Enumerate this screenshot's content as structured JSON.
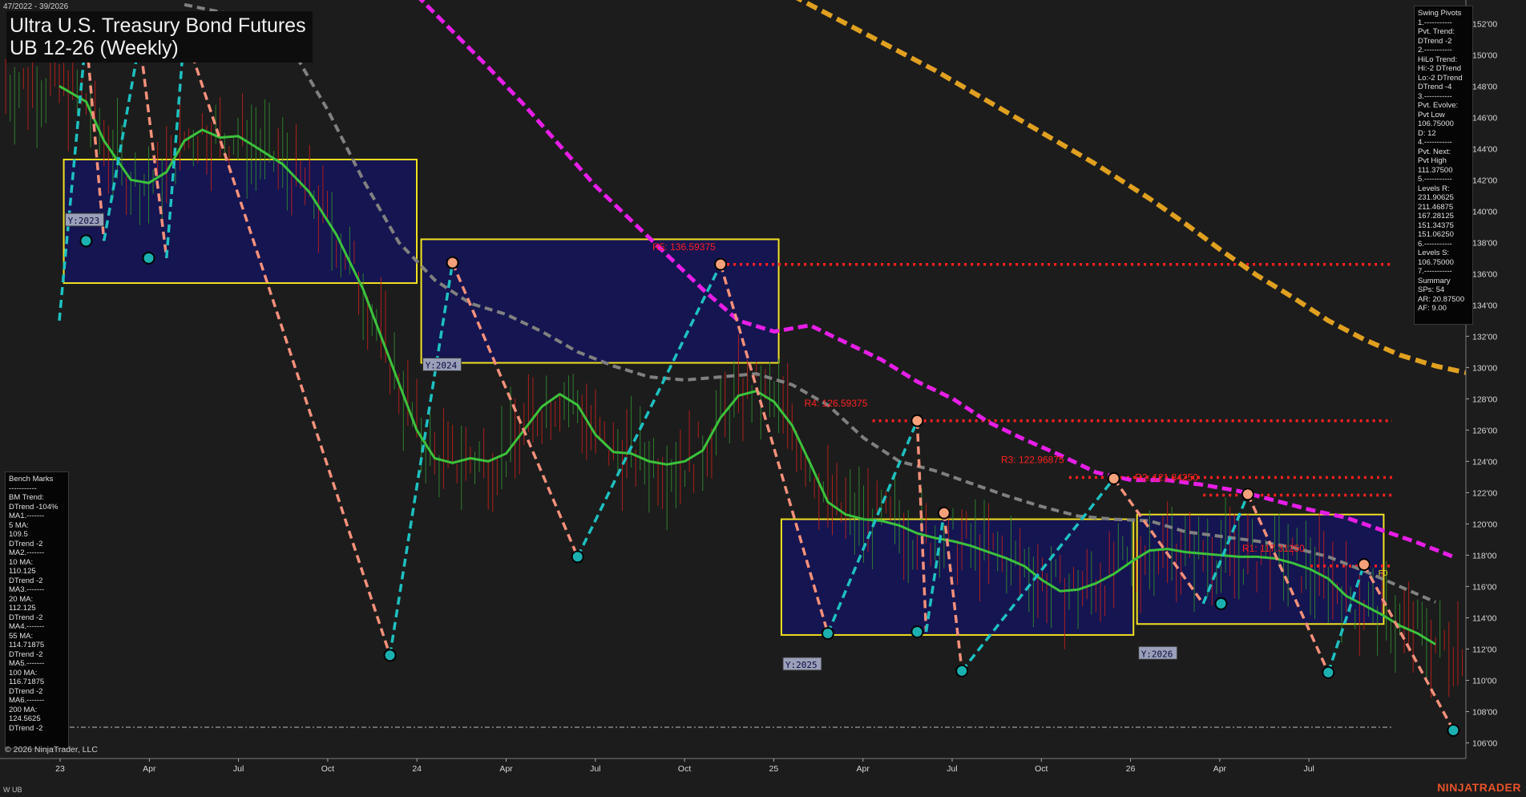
{
  "header": {
    "date_range": "47/2022 - 39/2026",
    "title_line1": "Ultra U.S. Treasury Bond Futures",
    "title_line2": "UB 12-26 (Weekly)"
  },
  "footer": {
    "copyright": "© 2026 NinjaTrader, LLC",
    "instrument": "W UB",
    "brand": "NINJATRADER"
  },
  "swing_panel": {
    "lines": [
      "Swing Pivots",
      "1.-----------",
      "Pvt. Trend:",
      "DTrend -2",
      "2.-----------",
      "HiLo Trend:",
      "Hi:-2 DTrend",
      "Lo:-2 DTrend",
      "DTrend -4",
      "3.-----------",
      "Pvt. Evolve:",
      "Pvt Low",
      "106.75000",
      "D: 12",
      "4.-----------",
      "Pvt. Next:",
      "Pvt High",
      "111.37500",
      "5.-----------",
      "Levels R:",
      "231.90625",
      "211.46875",
      "167.28125",
      "151.34375",
      "151.06250",
      "6.-----------",
      "Levels S:",
      "106.75000",
      "7.-----------",
      "Summary",
      "SPs: 54",
      "AR: 20.87500",
      "AF: 9.00"
    ]
  },
  "bench_panel": {
    "lines": [
      "Bench Marks",
      "-----------",
      "BM Trend:",
      "DTrend -104%",
      "MA1.-------",
      "5 MA:",
      "109.5",
      "DTrend -2",
      "MA2.-------",
      "10 MA:",
      "110.125",
      "DTrend -2",
      "MA3.-------",
      "20 MA:",
      "112.125",
      "DTrend -2",
      "MA4.-------",
      "55 MA:",
      "114.71875",
      "DTrend -2",
      "MA5.-------",
      "100 MA:",
      "116.71875",
      "DTrend -2",
      "MA6.-------",
      "200 MA:",
      "124.5625",
      "DTrend -2"
    ]
  },
  "colors": {
    "background": "#1c1c1c",
    "up_bar": "#2e8b2e",
    "down_bar": "#c0201a",
    "ma_fast": "#3cc23c",
    "ma_mid": "#808080",
    "ma_slow": "#e61ee6",
    "ma_longest": "#e0a020",
    "pivot_high": "#f4a07a",
    "pivot_low": "#1ab0b0",
    "swing_down": "#f4907a",
    "swing_up": "#1ec0c0",
    "resistance": "#ff2020",
    "year_box_fill": "#14145a",
    "year_box_border": "#f0e020"
  },
  "chart_data": {
    "type": "line",
    "x_axis": {
      "tick_labels": [
        "23",
        "Apr",
        "Jul",
        "Oct",
        "24",
        "Apr",
        "Jul",
        "Oct",
        "25",
        "Apr",
        "Jul",
        "Oct",
        "26",
        "Apr",
        "Jul"
      ]
    },
    "y_axis": {
      "ylim": [
        105,
        153.5
      ],
      "tick_labels": [
        "106'00",
        "108'00",
        "110'00",
        "112'00",
        "114'00",
        "116'00",
        "118'00",
        "120'00",
        "122'00",
        "124'00",
        "126'00",
        "128'00",
        "130'00",
        "132'00",
        "134'00",
        "136'00",
        "138'00",
        "140'00",
        "142'00",
        "144'00",
        "146'00",
        "148'00",
        "150'00",
        "152'00"
      ]
    },
    "year_boxes": [
      {
        "label": "Y:2023",
        "x0": 0.5,
        "x1": 40,
        "high": 143.3,
        "low": 135.4
      },
      {
        "label": "Y:2024",
        "x0": 40.5,
        "x1": 80.5,
        "high": 138.2,
        "low": 130.3
      },
      {
        "label": "Y:2025",
        "x0": 80.8,
        "x1": 120.2,
        "high": 120.3,
        "low": 112.9
      },
      {
        "label": "Y:2026",
        "x0": 120.6,
        "x1": 148.2,
        "high": 120.6,
        "low": 113.6
      }
    ],
    "resistance_levels": [
      {
        "label": "R5: 136.59375",
        "value": 136.59375,
        "x_start": 74
      },
      {
        "label": "R4: 126.59375",
        "value": 126.59375,
        "x_start": 91
      },
      {
        "label": "R3: 122.96875",
        "value": 122.96875,
        "x_start": 113
      },
      {
        "label": "R2: 121.84250",
        "value": 121.8425,
        "x_start": 128
      },
      {
        "label": "R1: 117.31250",
        "value": 117.3125,
        "x_start": 140
      }
    ],
    "f0_label": "F0",
    "support_level": 107.0,
    "pivot_lows": [
      [
        3,
        138.1
      ],
      [
        10,
        137.0
      ],
      [
        37,
        111.6
      ],
      [
        58,
        117.9
      ],
      [
        86,
        113.0
      ],
      [
        96,
        113.1
      ],
      [
        101,
        110.6
      ],
      [
        130,
        114.9
      ],
      [
        142,
        110.5
      ],
      [
        156,
        106.8
      ]
    ],
    "pivot_highs": [
      [
        3,
        151.3
      ],
      [
        10,
        150.9
      ],
      [
        44,
        136.7
      ],
      [
        74,
        136.6
      ],
      [
        96,
        126.6
      ],
      [
        99,
        120.7
      ],
      [
        118,
        122.9
      ],
      [
        133,
        121.9
      ],
      [
        146,
        117.4
      ]
    ],
    "swing_path": [
      [
        0,
        133
      ],
      [
        3,
        151.3
      ],
      [
        5,
        138.1
      ],
      [
        9,
        150.9
      ],
      [
        12,
        137.0
      ],
      [
        14,
        151.5
      ],
      [
        37,
        111.6
      ],
      [
        44,
        136.7
      ],
      [
        58,
        117.9
      ],
      [
        74,
        136.6
      ],
      [
        86,
        113.0
      ],
      [
        96,
        126.6
      ],
      [
        97,
        113.1
      ],
      [
        99,
        120.7
      ],
      [
        101,
        110.6
      ],
      [
        118,
        122.9
      ],
      [
        128,
        114.9
      ],
      [
        133,
        121.9
      ],
      [
        142,
        110.5
      ],
      [
        146,
        117.4
      ],
      [
        156,
        106.8
      ]
    ],
    "series": [
      {
        "name": "5 MA",
        "values": [
          [
            0,
            148
          ],
          [
            3,
            147
          ],
          [
            5,
            144.5
          ],
          [
            8,
            142
          ],
          [
            10,
            141.8
          ],
          [
            12,
            142.5
          ],
          [
            14,
            144.5
          ],
          [
            16,
            145.2
          ],
          [
            18,
            144.7
          ],
          [
            20,
            144.8
          ],
          [
            22,
            144.1
          ],
          [
            25,
            143
          ],
          [
            28,
            141.2
          ],
          [
            31,
            138.5
          ],
          [
            34,
            135
          ],
          [
            37,
            130.5
          ],
          [
            40,
            126
          ],
          [
            42,
            124.2
          ],
          [
            44,
            123.9
          ],
          [
            46,
            124.2
          ],
          [
            48,
            124
          ],
          [
            50,
            124.5
          ],
          [
            52,
            126
          ],
          [
            54,
            127.5
          ],
          [
            56,
            128.3
          ],
          [
            58,
            127.6
          ],
          [
            60,
            125.7
          ],
          [
            62,
            124.6
          ],
          [
            64,
            124.5
          ],
          [
            66,
            124
          ],
          [
            68,
            123.8
          ],
          [
            70,
            124
          ],
          [
            72,
            124.7
          ],
          [
            74,
            126.8
          ],
          [
            76,
            128.2
          ],
          [
            78,
            128.5
          ],
          [
            80,
            127.8
          ],
          [
            82,
            126.3
          ],
          [
            84,
            123.9
          ],
          [
            86,
            121.4
          ],
          [
            88,
            120.6
          ],
          [
            90,
            120.3
          ],
          [
            92,
            120.2
          ],
          [
            94,
            119.9
          ],
          [
            96,
            119.4
          ],
          [
            98,
            119.1
          ],
          [
            100,
            118.9
          ],
          [
            102,
            118.6
          ],
          [
            104,
            118.2
          ],
          [
            106,
            117.8
          ],
          [
            108,
            117.3
          ],
          [
            110,
            116.4
          ],
          [
            112,
            115.7
          ],
          [
            114,
            115.8
          ],
          [
            116,
            116.2
          ],
          [
            118,
            116.8
          ],
          [
            120,
            117.6
          ],
          [
            122,
            118.3
          ],
          [
            124,
            118.4
          ],
          [
            126,
            118.2
          ],
          [
            128,
            118.1
          ],
          [
            130,
            118.0
          ],
          [
            132,
            117.9
          ],
          [
            134,
            117.9
          ],
          [
            136,
            117.8
          ],
          [
            138,
            117.5
          ],
          [
            140,
            117.1
          ],
          [
            142,
            116.5
          ],
          [
            144,
            115.4
          ],
          [
            146,
            114.8
          ],
          [
            148,
            114.2
          ],
          [
            150,
            113.5
          ],
          [
            152,
            113.0
          ],
          [
            154,
            112.3
          ]
        ]
      },
      {
        "name": "20 MA",
        "values": [
          [
            14,
            153.2
          ],
          [
            20,
            152.5
          ],
          [
            26,
            150.4
          ],
          [
            30,
            146.5
          ],
          [
            34,
            142
          ],
          [
            38,
            138
          ],
          [
            42,
            135.6
          ],
          [
            46,
            134.1
          ],
          [
            50,
            133.4
          ],
          [
            54,
            132.3
          ],
          [
            58,
            131.0
          ],
          [
            62,
            130.1
          ],
          [
            66,
            129.4
          ],
          [
            70,
            129.2
          ],
          [
            74,
            129.4
          ],
          [
            78,
            129.6
          ],
          [
            82,
            128.9
          ],
          [
            86,
            127.6
          ],
          [
            90,
            125.5
          ],
          [
            94,
            124.0
          ],
          [
            98,
            123.4
          ],
          [
            102,
            122.6
          ],
          [
            106,
            121.8
          ],
          [
            110,
            121.1
          ],
          [
            114,
            120.5
          ],
          [
            118,
            120.3
          ],
          [
            122,
            120.2
          ],
          [
            126,
            119.5
          ],
          [
            130,
            119.2
          ],
          [
            134,
            118.9
          ],
          [
            138,
            118.5
          ],
          [
            142,
            117.9
          ],
          [
            146,
            117.0
          ],
          [
            150,
            116.0
          ],
          [
            154,
            115.0
          ]
        ]
      },
      {
        "name": "55 MA",
        "values": [
          [
            40,
            153.8
          ],
          [
            44,
            151.5
          ],
          [
            48,
            149.2
          ],
          [
            52,
            146.8
          ],
          [
            56,
            144.2
          ],
          [
            60,
            141.6
          ],
          [
            64,
            139.4
          ],
          [
            68,
            137.2
          ],
          [
            72,
            135.0
          ],
          [
            76,
            133.0
          ],
          [
            80,
            132.3
          ],
          [
            84,
            132.7
          ],
          [
            88,
            131.6
          ],
          [
            92,
            130.5
          ],
          [
            96,
            129.1
          ],
          [
            100,
            128.0
          ],
          [
            104,
            126.5
          ],
          [
            108,
            125.4
          ],
          [
            112,
            124.4
          ],
          [
            116,
            123.3
          ],
          [
            120,
            122.8
          ],
          [
            124,
            122.8
          ],
          [
            128,
            122.5
          ],
          [
            132,
            122.1
          ],
          [
            136,
            121.5
          ],
          [
            140,
            120.9
          ],
          [
            144,
            120.4
          ],
          [
            148,
            119.6
          ],
          [
            152,
            118.8
          ],
          [
            156,
            117.9
          ]
        ]
      },
      {
        "name": "200 MA",
        "values": [
          [
            82,
            153.8
          ],
          [
            86,
            152.6
          ],
          [
            92,
            150.8
          ],
          [
            98,
            149
          ],
          [
            104,
            147
          ],
          [
            110,
            145
          ],
          [
            116,
            143
          ],
          [
            122,
            140.8
          ],
          [
            126,
            139.2
          ],
          [
            130,
            137.5
          ],
          [
            134,
            135.9
          ],
          [
            138,
            134.5
          ],
          [
            142,
            133.0
          ],
          [
            146,
            131.8
          ],
          [
            150,
            130.8
          ],
          [
            154,
            130.1
          ],
          [
            158,
            129.6
          ],
          [
            162,
            129.0
          ],
          [
            166,
            128.3
          ],
          [
            170,
            127.7
          ],
          [
            174,
            127.3
          ],
          [
            178,
            126.9
          ],
          [
            182,
            126.6
          ],
          [
            186,
            126.3
          ],
          [
            190,
            126.0
          ],
          [
            194,
            125.8
          ],
          [
            198,
            125.6
          ],
          [
            202,
            125.4
          ]
        ]
      }
    ]
  }
}
